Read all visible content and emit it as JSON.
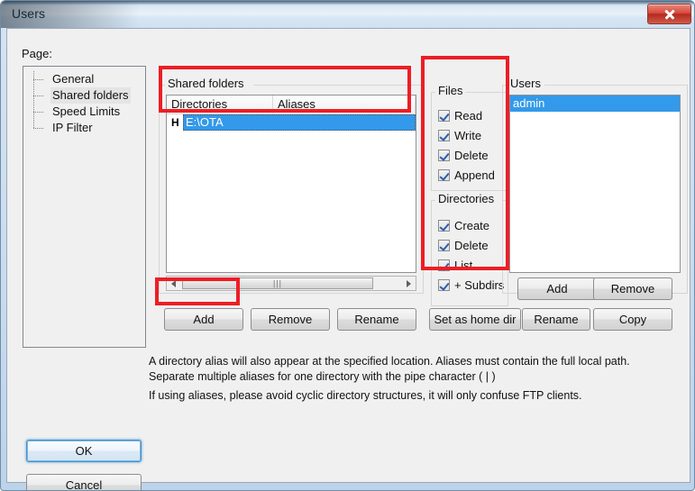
{
  "window": {
    "title": "Users",
    "close_label": "Close"
  },
  "left_pane": {
    "page_label": "Page:",
    "tree_items": [
      {
        "label": "General",
        "selected": false
      },
      {
        "label": "Shared folders",
        "selected": true
      },
      {
        "label": "Speed Limits",
        "selected": false
      },
      {
        "label": "IP Filter",
        "selected": false
      }
    ]
  },
  "shared_folders": {
    "legend": "Shared folders",
    "columns": [
      "Directories",
      "Aliases"
    ],
    "rows": [
      {
        "home_flag": "H",
        "directory": "E:\\OTA",
        "alias": "",
        "selected": true
      }
    ],
    "scrollbar": {
      "grip": "|||"
    },
    "buttons": {
      "add": "Add",
      "remove": "Remove",
      "rename": "Rename",
      "set_home": "Set as home dir"
    }
  },
  "permissions": {
    "files": {
      "legend": "Files",
      "items": [
        {
          "label": "Read",
          "checked": true
        },
        {
          "label": "Write",
          "checked": true
        },
        {
          "label": "Delete",
          "checked": true
        },
        {
          "label": "Append",
          "checked": true
        }
      ]
    },
    "directories": {
      "legend": "Directories",
      "items": [
        {
          "label": "Create",
          "checked": true
        },
        {
          "label": "Delete",
          "checked": true
        },
        {
          "label": "List",
          "checked": true
        },
        {
          "label": "+ Subdirs",
          "checked": true
        }
      ]
    }
  },
  "users": {
    "legend": "Users",
    "list": [
      {
        "name": "admin",
        "selected": true
      }
    ],
    "buttons": {
      "add": "Add",
      "remove": "Remove",
      "rename": "Rename",
      "copy": "Copy"
    }
  },
  "help": {
    "line1": "A directory alias will also appear at the specified location. Aliases must contain the full local path.",
    "line2": "Separate multiple aliases for one directory with the pipe character ( | )",
    "line3": "If using aliases, please avoid cyclic directory structures, it will only confuse FTP clients."
  },
  "dialog_buttons": {
    "ok": "OK",
    "cancel": "Cancel"
  },
  "annotations": {
    "highlight_color": "#ee1d24",
    "boxes": [
      "directories-list",
      "permissions-panel",
      "add-shared-folder-button"
    ]
  },
  "colors": {
    "selection_blue": "#3399ea",
    "window_chrome": "#d6e4f2",
    "client_background": "#f0f0f0",
    "close_button_red": "#d8493c"
  }
}
